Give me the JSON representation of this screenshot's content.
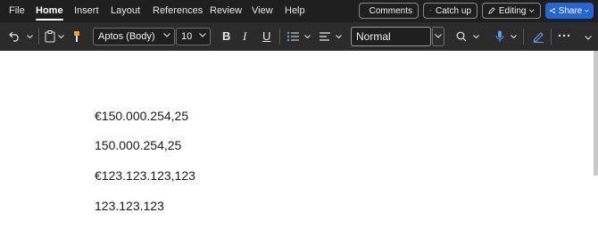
{
  "menu": {
    "tabs": [
      "File",
      "Home",
      "Insert",
      "Layout",
      "References",
      "Review",
      "View",
      "Help"
    ],
    "active_tab": "Home"
  },
  "header_actions": {
    "comments_label": "Comments",
    "catchup_label": "Catch up",
    "editing_label": "Editing",
    "share_label": "Share"
  },
  "ribbon": {
    "font_name": "Aptos (Body)",
    "font_size": "10",
    "bold_label": "B",
    "italic_label": "I",
    "underline_label": "U",
    "style_name": "Normal"
  },
  "document": {
    "paragraphs": [
      "€150.000.254,25",
      "150.000.254,25",
      "€123.123.123,123",
      "123.123.123"
    ]
  },
  "colors": {
    "menubar_bg": "#1f1f1f",
    "ribbon_bg": "#2b2b2b",
    "share_bg": "#2566d6",
    "page_bg": "#ffffff"
  }
}
